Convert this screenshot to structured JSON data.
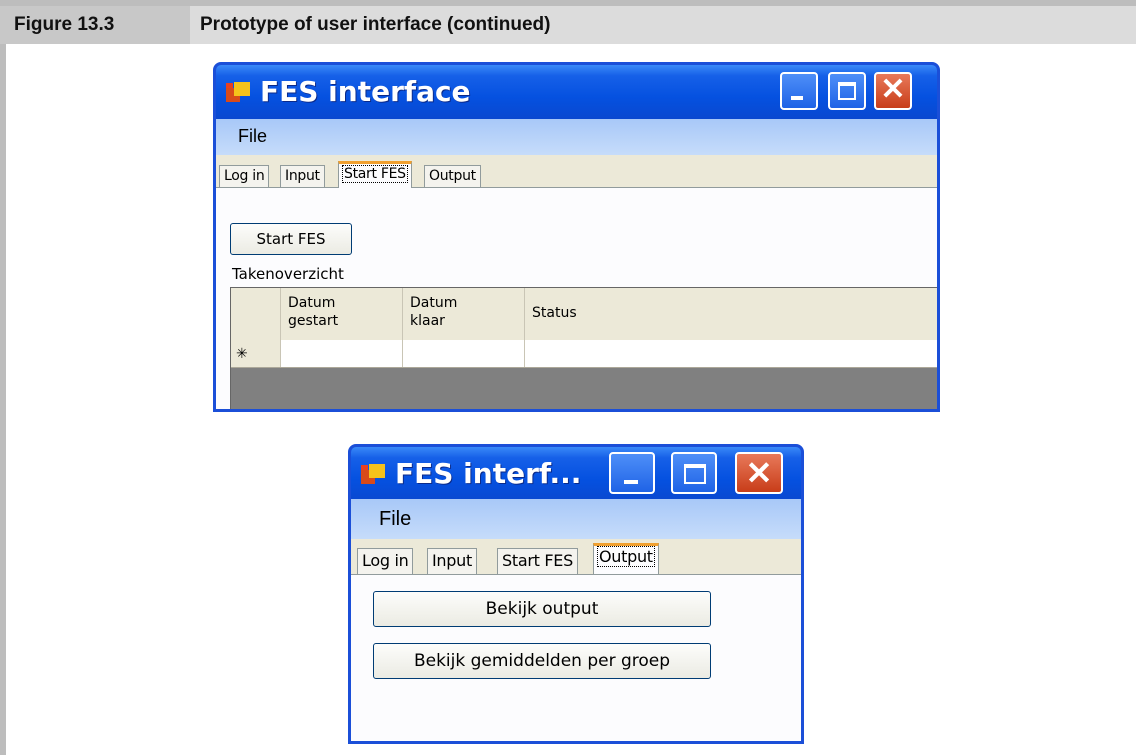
{
  "figure": {
    "number": "Figure 13.3",
    "title": "Prototype of user interface (continued)"
  },
  "window1": {
    "title": "FES interface",
    "menu": {
      "file": "File"
    },
    "tabs": [
      {
        "label": "Log in",
        "active": false
      },
      {
        "label": "Input",
        "active": false
      },
      {
        "label": "Start FES",
        "active": true
      },
      {
        "label": "Output",
        "active": false
      }
    ],
    "start_button": "Start FES",
    "grid_label": "Takenoverzicht",
    "grid": {
      "columns": [
        "Datum gestart",
        "Datum klaar",
        "Status"
      ],
      "new_row_marker": "✳"
    }
  },
  "window2": {
    "title": "FES interf...",
    "menu": {
      "file": "File"
    },
    "tabs": [
      {
        "label": "Log in",
        "active": false
      },
      {
        "label": "Input",
        "active": false
      },
      {
        "label": "Start FES",
        "active": false
      },
      {
        "label": "Output",
        "active": true
      }
    ],
    "buttons": [
      "Bekijk output",
      "Bekijk gemiddelden per groep"
    ]
  },
  "colors": {
    "titlebar": "#0551e0",
    "menubar": "#c6dcfa",
    "tab_active_accent": "#f0a030",
    "close_button": "#c83d19"
  }
}
